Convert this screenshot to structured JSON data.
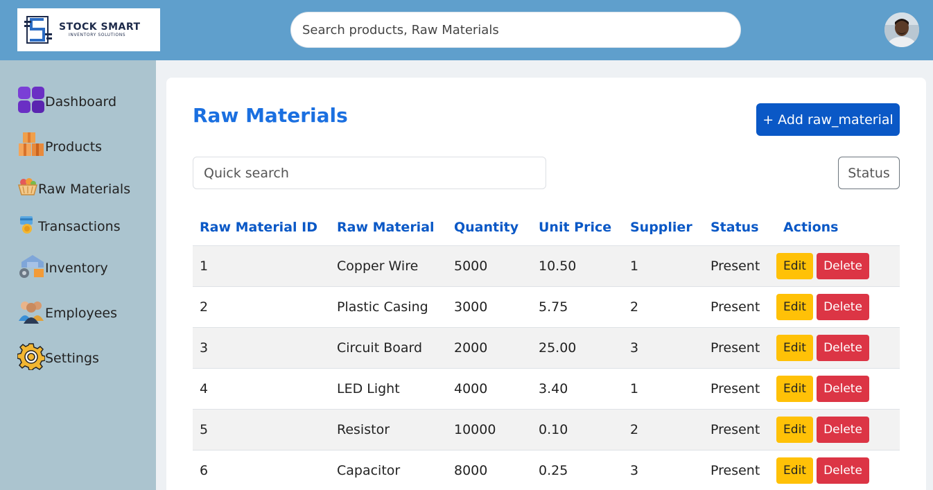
{
  "header": {
    "logo": {
      "name": "STOCK SMART",
      "tagline": "INVENTORY SOLUTIONS"
    },
    "search_placeholder": "Search products, Raw Materials",
    "avatar_icon": "user-avatar"
  },
  "sidebar": {
    "items": [
      {
        "label": "Dashboard",
        "icon": "dashboard-icon"
      },
      {
        "label": "Products",
        "icon": "boxes-icon"
      },
      {
        "label": "Raw Materials",
        "icon": "basket-icon"
      },
      {
        "label": "Transactions",
        "icon": "coins-icon"
      },
      {
        "label": "Inventory",
        "icon": "warehouse-icon"
      },
      {
        "label": "Employees",
        "icon": "people-icon"
      },
      {
        "label": "Settings",
        "icon": "gear-icon"
      }
    ]
  },
  "main": {
    "title": "Raw Materials",
    "add_button": "+ Add raw_material",
    "quick_search_placeholder": "Quick search",
    "status_button": "Status",
    "table": {
      "columns": [
        "Raw Material ID",
        "Raw Material",
        "Quantity",
        "Unit Price",
        "Supplier",
        "Status",
        "Actions"
      ],
      "rows": [
        [
          "1",
          "Copper Wire",
          "5000",
          "10.50",
          "1",
          "Present"
        ],
        [
          "2",
          "Plastic Casing",
          "3000",
          "5.75",
          "2",
          "Present"
        ],
        [
          "3",
          "Circuit Board",
          "2000",
          "25.00",
          "3",
          "Present"
        ],
        [
          "4",
          "LED Light",
          "4000",
          "3.40",
          "1",
          "Present"
        ],
        [
          "5",
          "Resistor",
          "10000",
          "0.10",
          "2",
          "Present"
        ],
        [
          "6",
          "Capacitor",
          "8000",
          "0.25",
          "3",
          "Present"
        ]
      ],
      "edit_label": "Edit",
      "delete_label": "Delete"
    }
  },
  "colors": {
    "topbar": "#5f9fcc",
    "sidebar": "#abc4cf",
    "accent": "#0a58c6",
    "title": "#1a6fe0",
    "edit": "#ffc107",
    "delete": "#dc3545"
  }
}
